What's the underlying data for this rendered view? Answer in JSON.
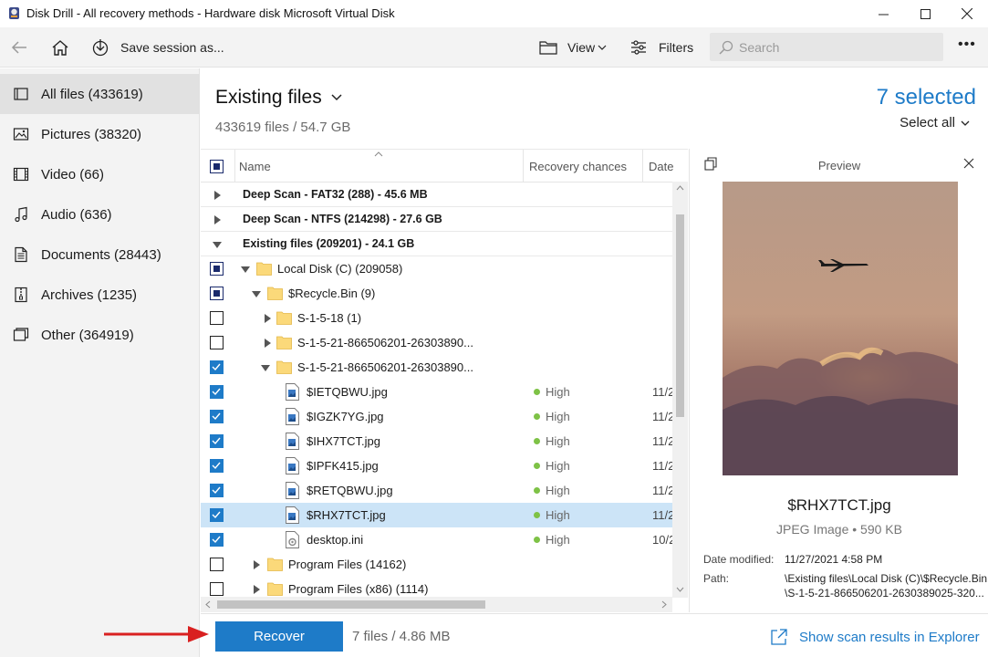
{
  "window": {
    "title": "Disk Drill - All recovery methods - Hardware disk Microsoft Virtual Disk",
    "minimize": "—",
    "maximize": "☐",
    "close": "✕"
  },
  "toolbar": {
    "save_session": "Save session as...",
    "view": "View",
    "filters": "Filters",
    "search_placeholder": "Search",
    "more": "•••"
  },
  "sidebar": {
    "items": [
      {
        "label": "All files (433619)",
        "icon": "all-files-icon"
      },
      {
        "label": "Pictures (38320)",
        "icon": "picture-icon"
      },
      {
        "label": "Video (66)",
        "icon": "video-icon"
      },
      {
        "label": "Audio (636)",
        "icon": "audio-icon"
      },
      {
        "label": "Documents (28443)",
        "icon": "document-icon"
      },
      {
        "label": "Archives (1235)",
        "icon": "archive-icon"
      },
      {
        "label": "Other (364919)",
        "icon": "other-icon"
      }
    ]
  },
  "main": {
    "title": "Existing files",
    "subtitle": "433619 files / 54.7 GB",
    "selected": "7 selected",
    "select_all": "Select all"
  },
  "table": {
    "columns": {
      "name": "Name",
      "chances": "Recovery chances",
      "date": "Date"
    },
    "rows": [
      {
        "name": "Deep Scan - FAT32 (288) - 45.6 MB",
        "chance": "",
        "date": ""
      },
      {
        "name": "Deep Scan - NTFS (214298) - 27.6 GB",
        "chance": "",
        "date": ""
      },
      {
        "name": "Existing files (209201) - 24.1 GB",
        "chance": "",
        "date": ""
      },
      {
        "name": "Local Disk (C) (209058)",
        "chance": "",
        "date": ""
      },
      {
        "name": "$Recycle.Bin (9)",
        "chance": "",
        "date": ""
      },
      {
        "name": "S-1-5-18 (1)",
        "chance": "",
        "date": ""
      },
      {
        "name": "S-1-5-21-866506201-26303890...",
        "chance": "",
        "date": ""
      },
      {
        "name": "S-1-5-21-866506201-26303890...",
        "chance": "",
        "date": ""
      },
      {
        "name": "$IETQBWU.jpg",
        "chance": "High",
        "date": "11/2"
      },
      {
        "name": "$IGZK7YG.jpg",
        "chance": "High",
        "date": "11/2"
      },
      {
        "name": "$IHX7TCT.jpg",
        "chance": "High",
        "date": "11/2"
      },
      {
        "name": "$IPFK415.jpg",
        "chance": "High",
        "date": "11/2"
      },
      {
        "name": "$RETQBWU.jpg",
        "chance": "High",
        "date": "11/2"
      },
      {
        "name": "$RHX7TCT.jpg",
        "chance": "High",
        "date": "11/2"
      },
      {
        "name": "desktop.ini",
        "chance": "High",
        "date": "10/2"
      },
      {
        "name": "Program Files (14162)",
        "chance": "",
        "date": ""
      },
      {
        "name": "Program Files (x86) (1114)",
        "chance": "",
        "date": ""
      }
    ]
  },
  "preview": {
    "title": "Preview",
    "filename": "$RHX7TCT.jpg",
    "filetype": "JPEG Image • 590 KB",
    "date_label": "Date modified:",
    "date_value": "11/27/2021 4:58 PM",
    "path_label": "Path:",
    "path_line1": "\\Existing files\\Local Disk (C)\\$Recycle.Bin",
    "path_line2": "\\S-1-5-21-866506201-2630389025-320..."
  },
  "bottom": {
    "recover": "Recover",
    "summary": "7 files / 4.86 MB",
    "show_explorer": "Show scan results in Explorer"
  },
  "colors": {
    "accent": "#1e7bc8",
    "high": "#7ec246",
    "arrow": "#d92020"
  }
}
